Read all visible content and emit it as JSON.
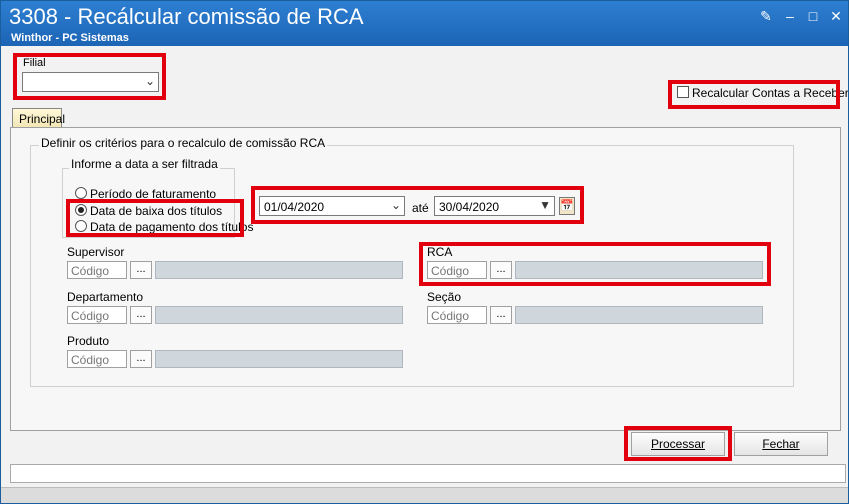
{
  "window": {
    "title": "3308 - Recálcular comissão de RCA",
    "subtitle": "Winthor - PC Sistemas"
  },
  "filial": {
    "label": "Filial",
    "value": ""
  },
  "recalcular_checkbox": {
    "label": "Recalcular Contas a Receber",
    "checked": false
  },
  "tabs": [
    {
      "label": "Principal",
      "selected": true
    }
  ],
  "criteria": {
    "group_title": "Definir os critérios para o recalculo de comissão RCA",
    "date_group_title": "Informe a data a ser filtrada",
    "radio_options": [
      {
        "label": "Período de faturamento",
        "selected": false
      },
      {
        "label": "Data de baixa dos títulos",
        "selected": true
      },
      {
        "label": "Data de pagamento dos títulos",
        "selected": false
      }
    ],
    "date_from": "01/04/2020",
    "date_to_label": "até",
    "date_to": "30/04/2020"
  },
  "filters": {
    "supervisor": {
      "label": "Supervisor",
      "placeholder": "Código"
    },
    "rca": {
      "label": "RCA",
      "placeholder": "Código"
    },
    "departamento": {
      "label": "Departamento",
      "placeholder": "Código"
    },
    "secao": {
      "label": "Seção",
      "placeholder": "Código"
    },
    "produto": {
      "label": "Produto",
      "placeholder": "Código"
    },
    "lookup_label": "..."
  },
  "buttons": {
    "processar": "Processar",
    "fechar": "Fechar"
  },
  "status": {
    "text": ""
  },
  "colors": {
    "titlebar": "#1d64b5",
    "highlight": "#e2000f"
  }
}
